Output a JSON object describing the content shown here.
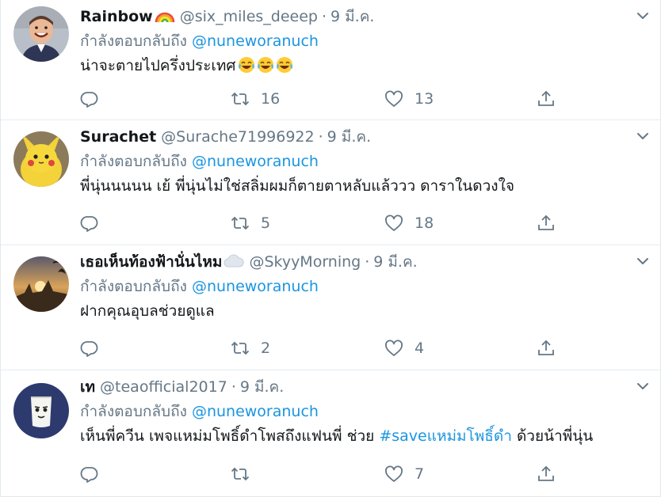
{
  "tweets": [
    {
      "name": "Rainbow",
      "name_emoji": "rainbow",
      "handle": "@six_miles_deeep",
      "separator": "·",
      "time": "9 มี.ค.",
      "replying_prefix": "กำลังตอบกลับถึง",
      "mention": "@nuneworanuch",
      "text": "น่าจะตายไปครึ่งประเทศ",
      "text_emojis": [
        "face-with-tears-of-joy",
        "face-with-tears-of-joy",
        "face-with-tears-of-joy"
      ],
      "reply_count": "",
      "retweet_count": "16",
      "like_count": "13",
      "avatar": "child-smiling"
    },
    {
      "name": "Surachet",
      "handle": "@Surache71996922",
      "separator": "·",
      "time": "9 มี.ค.",
      "replying_prefix": "กำลังตอบกลับถึง",
      "mention": "@nuneworanuch",
      "text": "พี่นุ่นนนนน เย้ พี่นุ่นไม่ใช่สลิ่มผมก็ตายตาหลับแล้ววว ดาราในดวงใจ",
      "reply_count": "",
      "retweet_count": "5",
      "like_count": "18",
      "avatar": "yellow-plush"
    },
    {
      "name": "เธอเห็นท้องฟ้านั่นไหม",
      "name_emoji": "cloud",
      "handle": "@SkyyMorning",
      "separator": "·",
      "time": "9 มี.ค.",
      "replying_prefix": "กำลังตอบกลับถึง",
      "mention": "@nuneworanuch",
      "text": "ฝากคุณอุบลช่วยดูแล",
      "reply_count": "",
      "retweet_count": "2",
      "like_count": "4",
      "avatar": "sunset-temple"
    },
    {
      "name": "เท",
      "handle": "@teaofficial2017",
      "separator": "·",
      "time": "9 มี.ค.",
      "replying_prefix": "กำลังตอบกลับถึง",
      "mention": "@nuneworanuch",
      "text_before": "เห็นพี่ควีน เพจแหม่มโพธิ์ดำโพสถึงแฟนพี่ ช่วย ",
      "hashtag": "#saveแหม่มโพธิ์ดำ",
      "text_after": " ด้วยน้าพี่นุ่น",
      "reply_count": "",
      "retweet_count": "",
      "like_count": "7",
      "avatar": "cup-character"
    }
  ],
  "icons": {
    "reply": "reply-icon",
    "retweet": "retweet-icon",
    "like": "heart-icon",
    "share": "share-icon",
    "more": "chevron-down-icon"
  },
  "colors": {
    "link": "#1b95e0",
    "secondary_text": "#657786",
    "primary_text": "#14171a",
    "divider": "#e6ecf0"
  }
}
